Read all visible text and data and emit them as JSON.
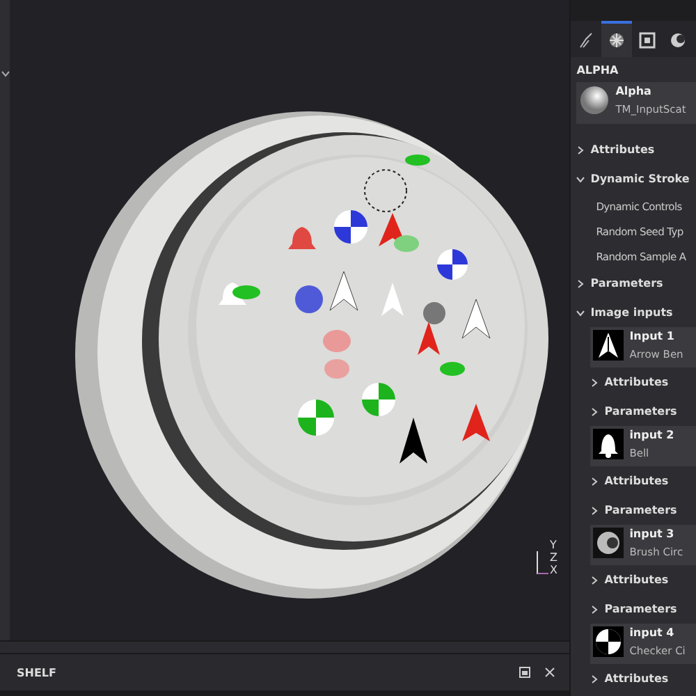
{
  "viewport": {
    "axes": [
      "Y",
      "Z",
      "X"
    ]
  },
  "shelf": {
    "title": "SHELF"
  },
  "panel": {
    "tabs": [
      {
        "selected": false
      },
      {
        "selected": true
      },
      {
        "selected": false
      },
      {
        "selected": false
      }
    ],
    "header": "ALPHA",
    "alpha": {
      "name": "Alpha",
      "resource": "TM_InputScat"
    },
    "items": [
      {
        "kind": "section",
        "label": "Attributes",
        "expanded": false
      },
      {
        "kind": "section",
        "label": "Dynamic Stroke",
        "expanded": true
      },
      {
        "kind": "property",
        "label": "Dynamic Controls"
      },
      {
        "kind": "property",
        "label": "Random Seed Typ"
      },
      {
        "kind": "property",
        "label": "Random Sample A"
      },
      {
        "kind": "section",
        "label": "Parameters",
        "expanded": false
      },
      {
        "kind": "section",
        "label": "Image inputs",
        "expanded": true
      },
      {
        "kind": "input",
        "label": "Input 1",
        "resource": "Arrow Ben"
      },
      {
        "kind": "subsection",
        "label": "Attributes",
        "expanded": false
      },
      {
        "kind": "subsection",
        "label": "Parameters",
        "expanded": false
      },
      {
        "kind": "input",
        "label": "input 2",
        "resource": "Bell"
      },
      {
        "kind": "subsection",
        "label": "Attributes",
        "expanded": false
      },
      {
        "kind": "subsection",
        "label": "Parameters",
        "expanded": false
      },
      {
        "kind": "input",
        "label": "input 3",
        "resource": "Brush Circ"
      },
      {
        "kind": "subsection",
        "label": "Attributes",
        "expanded": false
      },
      {
        "kind": "subsection",
        "label": "Parameters",
        "expanded": false
      },
      {
        "kind": "input",
        "label": "input 4",
        "resource": "Checker Ci"
      },
      {
        "kind": "subsection",
        "label": "Attributes",
        "expanded": false
      }
    ]
  }
}
